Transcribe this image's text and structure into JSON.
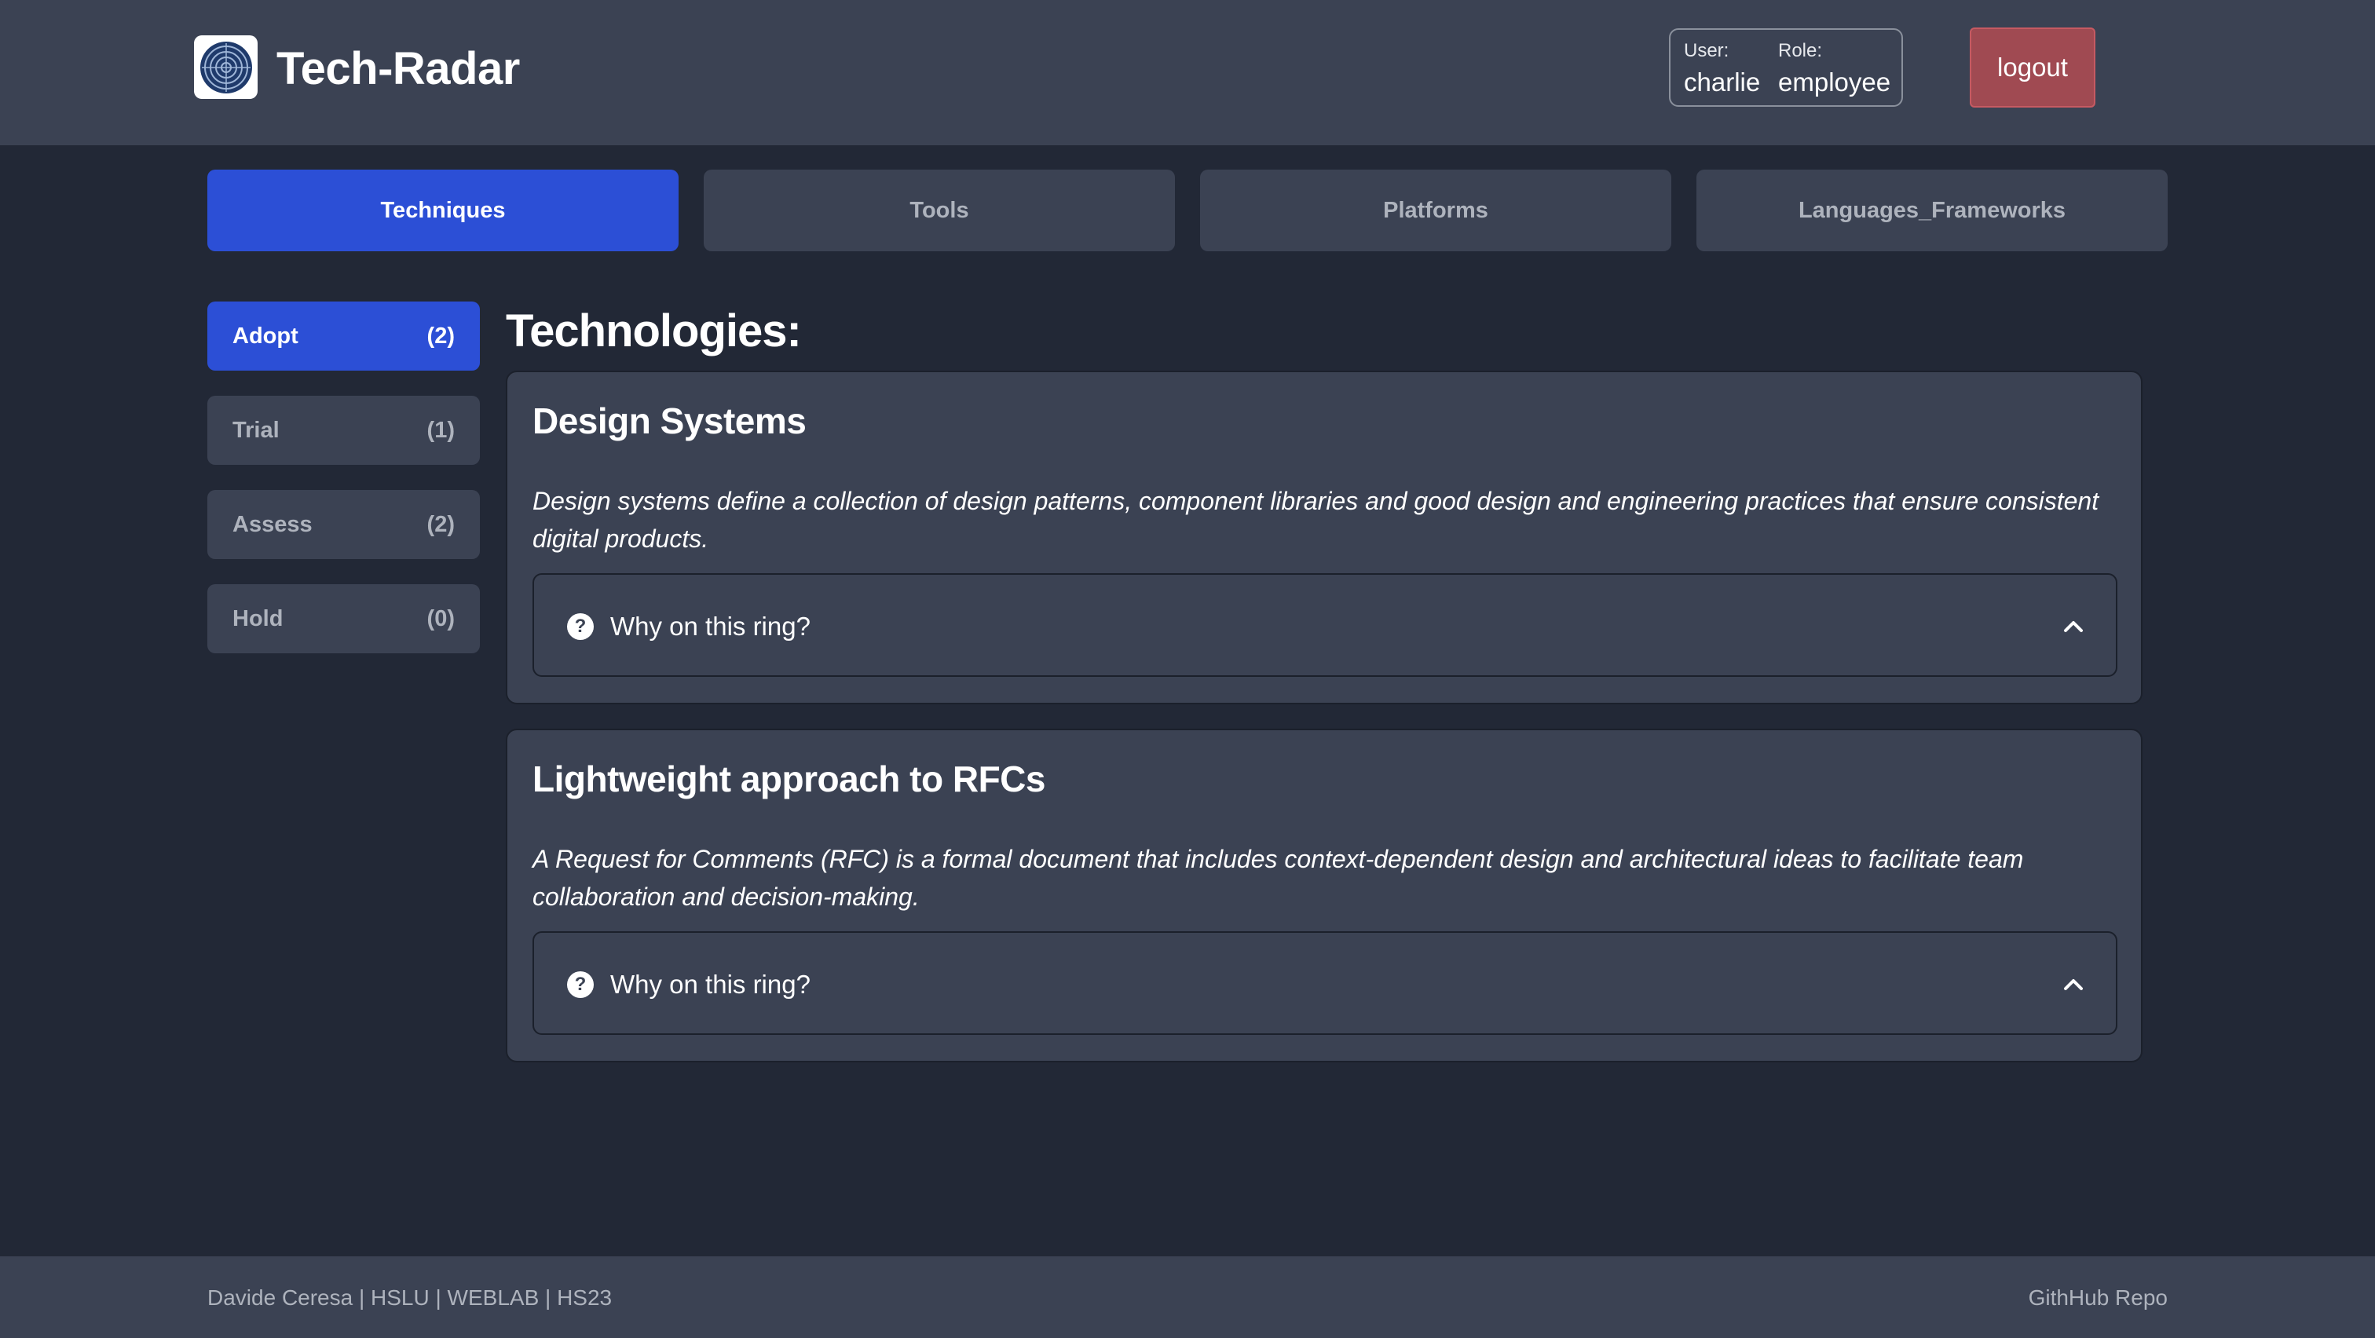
{
  "header": {
    "app_title": "Tech-Radar",
    "user_label": "User:",
    "user_value": "charlie",
    "role_label": "Role:",
    "role_value": "employee",
    "logout_label": "logout"
  },
  "tabs": [
    {
      "label": "Techniques",
      "active": true
    },
    {
      "label": "Tools",
      "active": false
    },
    {
      "label": "Platforms",
      "active": false
    },
    {
      "label": "Languages_Frameworks",
      "active": false
    }
  ],
  "rings": [
    {
      "label": "Adopt",
      "count": "(2)",
      "active": true
    },
    {
      "label": "Trial",
      "count": "(1)",
      "active": false
    },
    {
      "label": "Assess",
      "count": "(2)",
      "active": false
    },
    {
      "label": "Hold",
      "count": "(0)",
      "active": false
    }
  ],
  "main": {
    "section_title": "Technologies:",
    "cards": [
      {
        "title": "Design Systems",
        "description": "Design systems define a collection of design patterns, component libraries and good design and engineering practices that ensure consistent digital products.",
        "accordion_label": "Why on this ring?"
      },
      {
        "title": "Lightweight approach to RFCs",
        "description": "A Request for Comments (RFC) is a formal document that includes context-dependent design and architectural ideas to facilitate team collaboration and decision-making.",
        "accordion_label": "Why on this ring?"
      }
    ]
  },
  "footer": {
    "credits": "Davide Ceresa | HSLU | WEBLAB | HS23",
    "repo_link": "GithHub Repo"
  },
  "icons": {
    "logo": "radar-logo-icon",
    "accordion_icon": "question-circle-icon",
    "accordion_toggle": "chevron-up-icon"
  },
  "colors": {
    "accent": "#2c4fd6",
    "logout": "#a04a52",
    "surface": "#3b4253",
    "background": "#222836"
  }
}
